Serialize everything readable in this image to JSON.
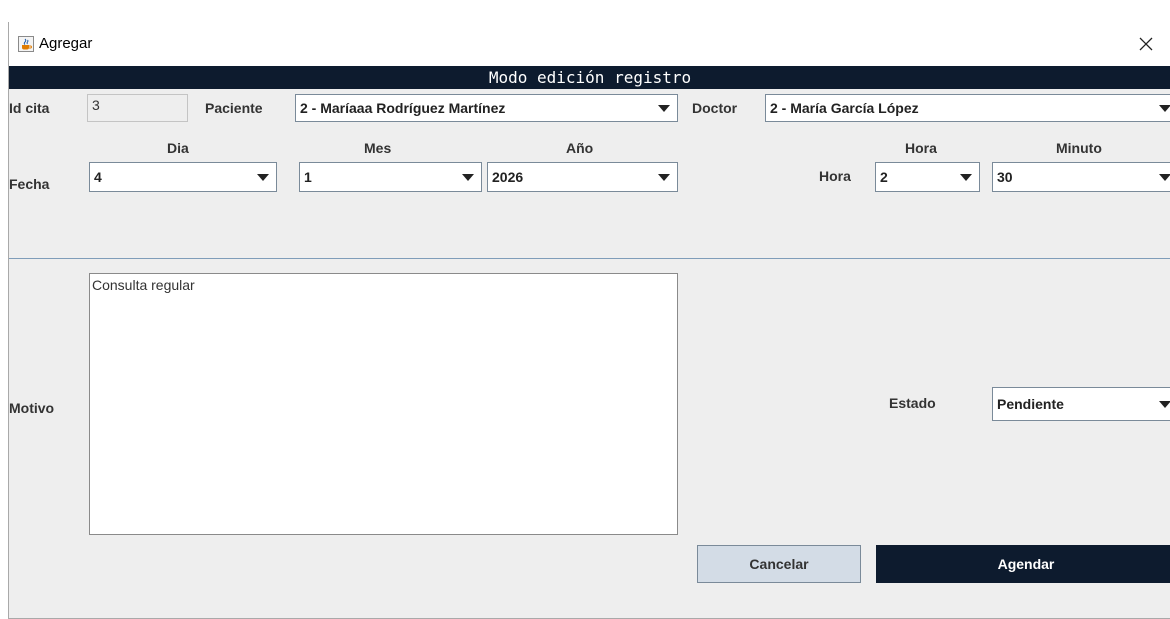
{
  "window": {
    "title": "Agregar",
    "icon": "java-cup-icon",
    "close": "✕"
  },
  "banner": "Modo edición registro",
  "form": {
    "id_cita": {
      "label": "Id cita",
      "value": "3"
    },
    "paciente": {
      "label": "Paciente",
      "value": "2 - Maríaaa Rodríguez Martínez"
    },
    "doctor": {
      "label": "Doctor",
      "value": "2 - María García López"
    },
    "fecha": {
      "label": "Fecha",
      "dia": {
        "label": "Dia",
        "value": "4"
      },
      "mes": {
        "label": "Mes",
        "value": "1"
      },
      "anio": {
        "label": "Año",
        "value": "2026"
      }
    },
    "hora": {
      "label": "Hora",
      "hora": {
        "label": "Hora",
        "value": "2"
      },
      "minuto": {
        "label": "Minuto",
        "value": "30"
      }
    },
    "motivo": {
      "label": "Motivo",
      "value": "Consulta regular"
    },
    "estado": {
      "label": "Estado",
      "value": "Pendiente"
    }
  },
  "buttons": {
    "cancel": "Cancelar",
    "submit": "Agendar"
  },
  "colors": {
    "accent": "#0d1b2e",
    "cancel_bg": "#d3dce6",
    "window_bg": "#eeeeee"
  }
}
